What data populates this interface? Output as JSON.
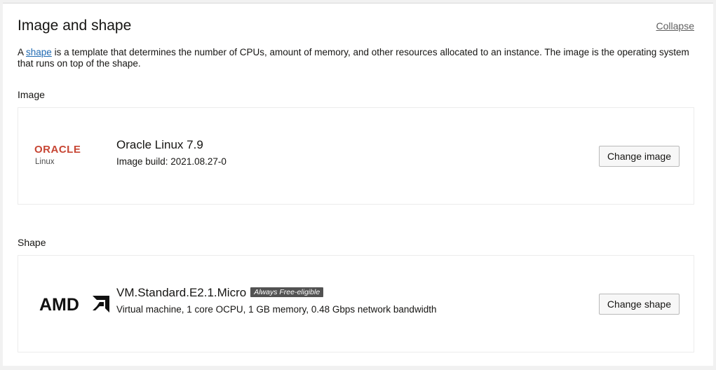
{
  "section": {
    "title": "Image and shape",
    "collapse_label": "Collapse",
    "description_prefix": "A ",
    "description_link": "shape",
    "description_suffix": " is a template that determines the number of CPUs, amount of memory, and other resources allocated to an instance. The image is the operating system that runs on top of the shape."
  },
  "image": {
    "label": "Image",
    "logo_text": "ORACLE",
    "logo_subtext": "Linux",
    "name": "Oracle Linux 7.9",
    "build": "Image build: 2021.08.27-0",
    "button_label": "Change image"
  },
  "shape": {
    "label": "Shape",
    "logo_text": "AMD",
    "name": "VM.Standard.E2.1.Micro",
    "badge": "Always Free-eligible",
    "details": "Virtual machine, 1 core OCPU, 1 GB memory, 0.48 Gbps network bandwidth",
    "button_label": "Change shape"
  },
  "colors": {
    "oracle_red": "#c74634",
    "link_blue": "#1f6ab3",
    "badge_bg": "#525252"
  }
}
